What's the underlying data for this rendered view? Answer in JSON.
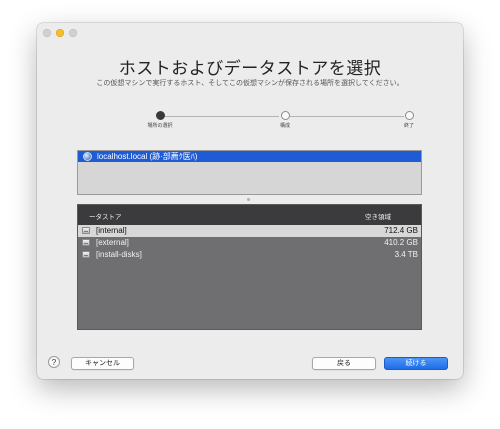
{
  "dialog": {
    "title": "ホストおよびデータストアを選択",
    "subtitle": "この仮想マシンで実行するホスト、そしてこの仮想マシンが保存される場所を選択してください。"
  },
  "stepper": {
    "steps": [
      {
        "label": "場所の選択",
        "state": "current"
      },
      {
        "label": "構成",
        "state": "pending"
      },
      {
        "label": "終了",
        "state": "pending"
      }
    ]
  },
  "host_list": {
    "items": [
      {
        "label": "localhost.local (跡·部薦ｸ医ﾊ)",
        "icon": "globe-icon",
        "selected": true
      }
    ]
  },
  "datastore_table": {
    "columns": [
      "ータストア",
      "空き領域"
    ],
    "rows": [
      {
        "name": "[internal]",
        "free": "712.4 GB",
        "selected": true,
        "icon": "disk-icon"
      },
      {
        "name": "[external]",
        "free": "410.2 GB",
        "selected": false,
        "icon": "disk-icon"
      },
      {
        "name": "[install-disks]",
        "free": "3.4 TB",
        "selected": false,
        "icon": "disk-icon"
      }
    ]
  },
  "footer": {
    "help_label": "?",
    "cancel_label": "キャンセル",
    "back_label": "戻る",
    "continue_label": "続ける"
  },
  "colors": {
    "accent": "#1e5bd4",
    "primary_button": "#1f6ee8",
    "table_bg": "#6f6f72",
    "table_header": "#3b3b3d"
  }
}
